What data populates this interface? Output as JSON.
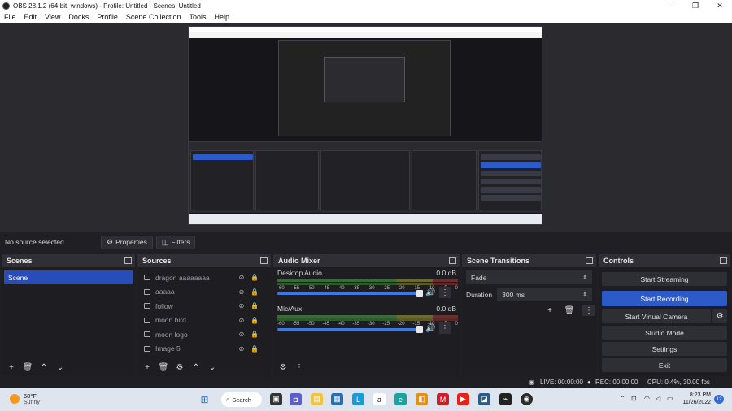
{
  "window": {
    "title": "OBS 28.1.2 (64-bit, windows) - Profile: Untitled - Scenes: Untitled",
    "controls": [
      "─",
      "❐",
      "✕"
    ]
  },
  "menu": [
    "File",
    "Edit",
    "View",
    "Docks",
    "Profile",
    "Scene Collection",
    "Tools",
    "Help"
  ],
  "source_bar": {
    "no_source": "No source selected",
    "properties_label": "Properties",
    "filters_label": "Filters"
  },
  "scenes": {
    "title": "Scenes",
    "items": [
      "Scene"
    ]
  },
  "sources": {
    "title": "Sources",
    "items": [
      "dragon aaaaaaaa",
      "aaaaa",
      "follow",
      "moon bird",
      "moon logo",
      "Image 5"
    ]
  },
  "mixer": {
    "title": "Audio Mixer",
    "channels": [
      {
        "name": "Desktop Audio",
        "db": "0.0 dB"
      },
      {
        "name": "Mic/Aux",
        "db": "0.0 dB"
      }
    ],
    "ticks": [
      "-60",
      "-55",
      "-50",
      "-45",
      "-40",
      "-35",
      "-30",
      "-25",
      "-20",
      "-15",
      "-10",
      "-5",
      "0"
    ]
  },
  "transitions": {
    "title": "Scene Transitions",
    "selected": "Fade",
    "duration_label": "Duration",
    "duration_value": "300 ms"
  },
  "controls": {
    "title": "Controls",
    "buttons": [
      "Start Streaming",
      "Start Recording",
      "Start Virtual Camera",
      "Studio Mode",
      "Settings",
      "Exit"
    ]
  },
  "status": {
    "live": "LIVE: 00:00:00",
    "rec": "REC: 00:00:00",
    "cpu": "CPU: 0.4%, 30.00 fps"
  },
  "taskbar": {
    "temp": "68°F",
    "weather": "Sunny",
    "search": "Search",
    "time": "8:23 PM",
    "date": "11/26/2022",
    "notifications": "12"
  },
  "colors": {
    "accent": "#2c5ac8",
    "panel": "#27272c",
    "background": "#202024"
  }
}
